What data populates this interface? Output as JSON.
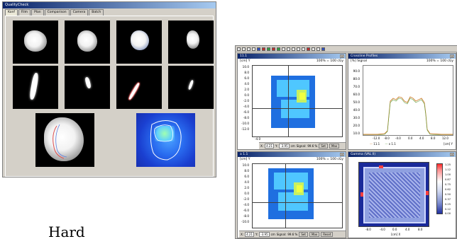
{
  "left_app": {
    "title": "QualityCheck",
    "tabs": [
      "Konf",
      "Film",
      "Plan",
      "Comparison",
      "Camera",
      "Batch"
    ],
    "active_tab": 0
  },
  "right_app": {
    "pane1": {
      "title": "11.1",
      "axis_label": "[cm] Y",
      "scale_label": "100% = 100 cGy",
      "y_ticks": [
        "10.0",
        "8.0",
        "6.0",
        "4.0",
        "2.0",
        "0.0",
        "-2.0",
        "-4.0",
        "-6.0",
        "-8.0",
        "-10.0",
        "-12.0"
      ],
      "x_tick": "-4.0",
      "status": {
        "x": "4.21",
        "y": "-3.95",
        "unit": "cm",
        "signal_label": "Signal:",
        "signal": "99.6 %",
        "set_label": "Set",
        "max_label": "Max"
      }
    },
    "pane2": {
      "title": "Crossline Profiles",
      "axis_label": "[%] Signal",
      "scale_label": "100% = 100 cGy",
      "y_ticks": [
        "90.0",
        "80.0",
        "70.0",
        "60.0",
        "50.0",
        "40.0",
        "30.0",
        "20.0",
        "10.0"
      ],
      "x_ticks": [
        "-12.0",
        "-8.0",
        "-4.0",
        "0.0",
        "4.0",
        "8.0",
        "12.0"
      ],
      "x_unit": "[cm] Y",
      "legend": [
        "11.1",
        "x 1.1"
      ]
    },
    "pane3": {
      "title": "a 1.1",
      "axis_label": "[cm] Y",
      "scale_label": "100% = 100 cGy",
      "y_ticks": [
        "10.0",
        "8.0",
        "6.0",
        "4.0",
        "2.0",
        "0.0",
        "-2.0",
        "-4.0",
        "-6.0",
        "-8.0",
        "-10.0"
      ],
      "status": {
        "x": "4.21",
        "y": "-3.95",
        "unit": "cm",
        "signal_label": "Signal:",
        "signal": "99.6 %",
        "set_label": "Set",
        "max_label": "Max",
        "reset_label": "Reset"
      }
    },
    "pane4": {
      "title": "Gamma (VAL II)",
      "x_ticks": [
        "-8.0",
        "-4.0",
        "0.0",
        "4.0",
        "8.0"
      ],
      "x_unit": "[cm] X",
      "colorbar": [
        "1.25",
        "1.12",
        "1.00",
        "0.87",
        "0.75",
        "0.62",
        "0.50",
        "0.37",
        "0.25",
        "0.12",
        "0.00"
      ]
    }
  },
  "caption": "Hard"
}
